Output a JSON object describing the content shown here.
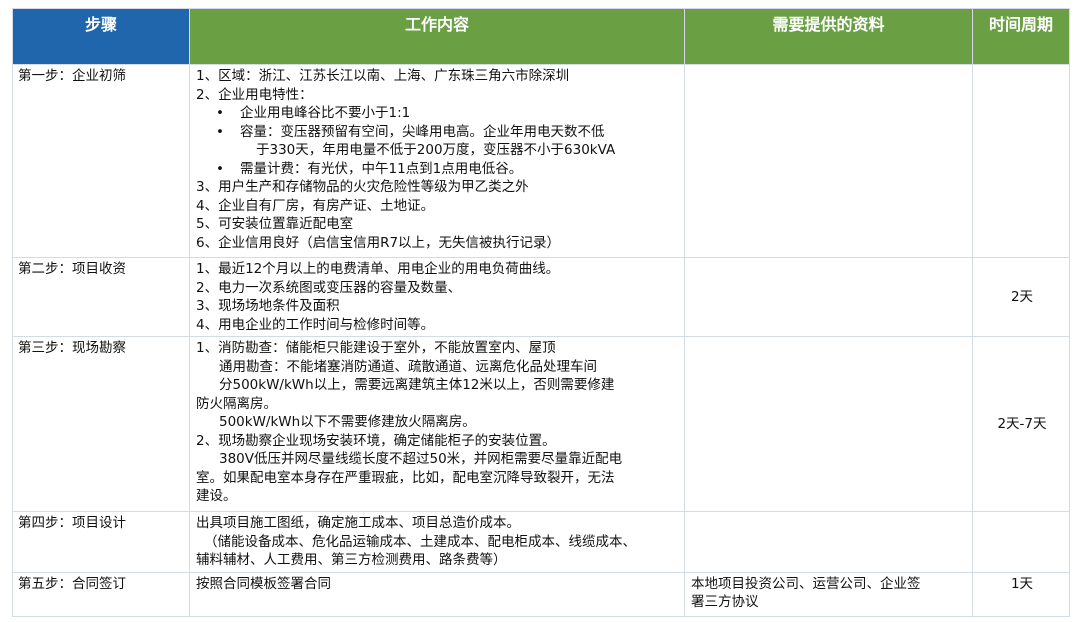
{
  "header": {
    "col1": "步骤",
    "col2": "工作内容",
    "col3": "需要提供的资料",
    "col4": "时间周期"
  },
  "rows": [
    {
      "step": "第一步：企业初筛",
      "lines": [
        "1、区域：浙江、江苏长江以南、上海、广东珠三角六市除深圳",
        "2、企业用电特性：",
        "企业用电峰谷比不要小于1:1",
        "容量：变压器预留有空间，尖峰用电高。企业年用电天数不低",
        "于330天，年用电量不低于200万度，变压器不小于630kVA",
        "需量计费：有光伏，中午11点到1点用电低谷。",
        "3、用户生产和存储物品的火灾危险性等级为甲乙类之外",
        "4、企业自有厂房，有房产证、土地证。",
        "5、可安装位置靠近配电室",
        "6、企业信用良好（启信宝信用R7以上，无失信被执行记录）"
      ],
      "materials": "",
      "period": ""
    },
    {
      "step": "第二步：项目收资",
      "lines": [
        "1、最近12个月以上的电费清单、用电企业的用电负荷曲线。",
        "2、电力一次系统图或变压器的容量及数量、",
        "3、现场场地条件及面积",
        "4、用电企业的工作时间与检修时间等。"
      ],
      "materials": "",
      "period": "2天"
    },
    {
      "step": "第三步：现场勘察",
      "lines": [
        "1、消防勘查：储能柜只能建设于室外，不能放置室内、屋顶",
        "通用勘查：不能堵塞消防通道、疏散通道、远离危化品处理车间",
        "分500kW/kWh以上，需要远离建筑主体12米以上，否则需要修建",
        "防火隔离房。",
        "500kW/kWh以下不需要修建放火隔离房。",
        "2、现场勘察企业现场安装环境，确定储能柜子的安装位置。",
        "380V低压并网尽量线缆长度不超过50米，并网柜需要尽量靠近配电",
        "室。如果配电室本身存在严重瑕疵，比如，配电室沉降导致裂开，无法",
        "建设。"
      ],
      "materials": "",
      "period": "2天-7天"
    },
    {
      "step": "第四步：项目设计",
      "lines": [
        "出具项目施工图纸，确定施工成本、项目总造价成本。",
        "（储能设备成本、危化品运输成本、土建成本、配电柜成本、线缆成本、",
        "辅料辅材、人工费用、第三方检测费用、路条费等）"
      ],
      "materials": "",
      "period": ""
    },
    {
      "step": "第五步：合同签订",
      "lines": [
        "按照合同模板签署合同"
      ],
      "materials_lines": [
        "本地项目投资公司、运营公司、企业签",
        "署三方协议"
      ],
      "period": "1天"
    }
  ],
  "bullet_glyph": "•"
}
